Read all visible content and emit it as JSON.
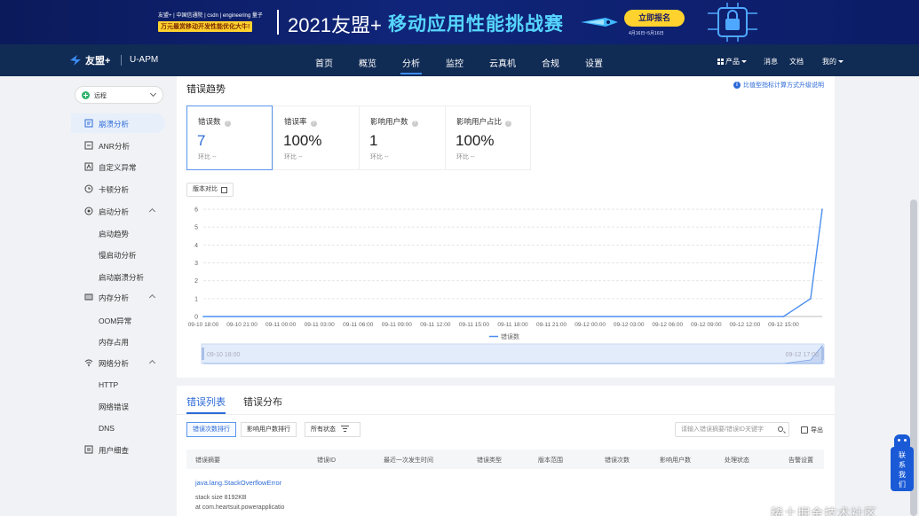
{
  "banner": {
    "logos_text": "友盟+  |  中国信通院  |  csdn  |  engineering 量子",
    "award_text": "万元最赏移动开发性能优化大牛!",
    "year": "2021友盟+",
    "headline": "移动应用性能挑战赛",
    "button": "立即报名",
    "date": "4月16日~5月16日"
  },
  "topnav": {
    "logo": "友盟+",
    "product": "U-APM",
    "items": [
      "首页",
      "概览",
      "分析",
      "监控",
      "云真机",
      "合规",
      "设置"
    ],
    "active_item": "分析",
    "right": {
      "product": "产品",
      "messages": "消息",
      "docs": "文档",
      "me": "我的"
    }
  },
  "sidebar": {
    "scope": "远程",
    "items": [
      {
        "label": "崩溃分析",
        "icon": "crash-report-icon",
        "active": true
      },
      {
        "label": "ANR分析",
        "icon": "anr-icon"
      },
      {
        "label": "自定义异常",
        "icon": "custom-error-icon"
      },
      {
        "label": "卡顿分析",
        "icon": "clock-icon"
      },
      {
        "label": "启动分析",
        "icon": "launch-icon",
        "expanded": true,
        "children": [
          "启动趋势",
          "慢启动分析",
          "启动崩溃分析"
        ]
      },
      {
        "label": "内存分析",
        "icon": "memory-icon",
        "expanded": true,
        "children": [
          "OOM异常",
          "内存占用"
        ]
      },
      {
        "label": "网络分析",
        "icon": "wifi-icon",
        "expanded": true,
        "children": [
          "HTTP",
          "网络错误",
          "DNS"
        ]
      },
      {
        "label": "用户细查",
        "icon": "user-detail-icon"
      }
    ]
  },
  "trend": {
    "title": "错误趋势",
    "info_link": "比值型指标计算方式升级说明",
    "metrics": [
      {
        "label": "错误数",
        "value": "7",
        "comp_label": "环比",
        "comp_value": "--"
      },
      {
        "label": "错误率",
        "value": "100%",
        "comp_label": "环比",
        "comp_value": "--"
      },
      {
        "label": "影响用户数",
        "value": "1",
        "comp_label": "环比",
        "comp_value": "--"
      },
      {
        "label": "影响用户占比",
        "value": "100%",
        "comp_label": "环比",
        "comp_value": "--"
      }
    ],
    "version_compare": "版本对比"
  },
  "chart_data": {
    "type": "line",
    "x": [
      "09-10 18:00",
      "09-10 21:00",
      "09-11 00:00",
      "09-11 03:00",
      "09-11 06:00",
      "09-11 09:00",
      "09-11 12:00",
      "09-11 15:00",
      "09-11 18:00",
      "09-11 21:00",
      "09-12 00:00",
      "09-12 03:00",
      "09-12 06:00",
      "09-12 09:00",
      "09-12 12:00",
      "09-12 15:00"
    ],
    "y_ticks": [
      0,
      1,
      2,
      3,
      4,
      5,
      6
    ],
    "ylim": [
      0,
      6
    ],
    "series": [
      {
        "name": "错误数",
        "color": "#4a8ff0",
        "x_index": [
          0,
          15,
          15.7,
          16
        ],
        "values": [
          0,
          0,
          1,
          6
        ]
      }
    ],
    "legend": "bottom-center",
    "grid": true,
    "slider_start": "09-10 18:00",
    "slider_end": "09-12 17:00"
  },
  "list": {
    "tabs": [
      "错误列表",
      "错误分布"
    ],
    "sort_options": [
      "错误次数排行",
      "影响用户数排行"
    ],
    "status_filter": "所有状态",
    "search_placeholder": "请输入错误摘要/错误ID关键字",
    "export": "导出",
    "columns": [
      "错误摘要",
      "错误ID",
      "最近一次发生时间",
      "错误类型",
      "版本范围",
      "错误次数",
      "影响用户数",
      "处理状态",
      "告警设置"
    ],
    "rows": [
      {
        "summary": "java.lang.StackOverflowError",
        "lines": [
          "stack size 8192KB",
          "at com.heartsuit.powerapplicatio"
        ]
      }
    ]
  },
  "contact": {
    "label": "联系我们"
  },
  "watermark": "稀土掘金技术社区"
}
